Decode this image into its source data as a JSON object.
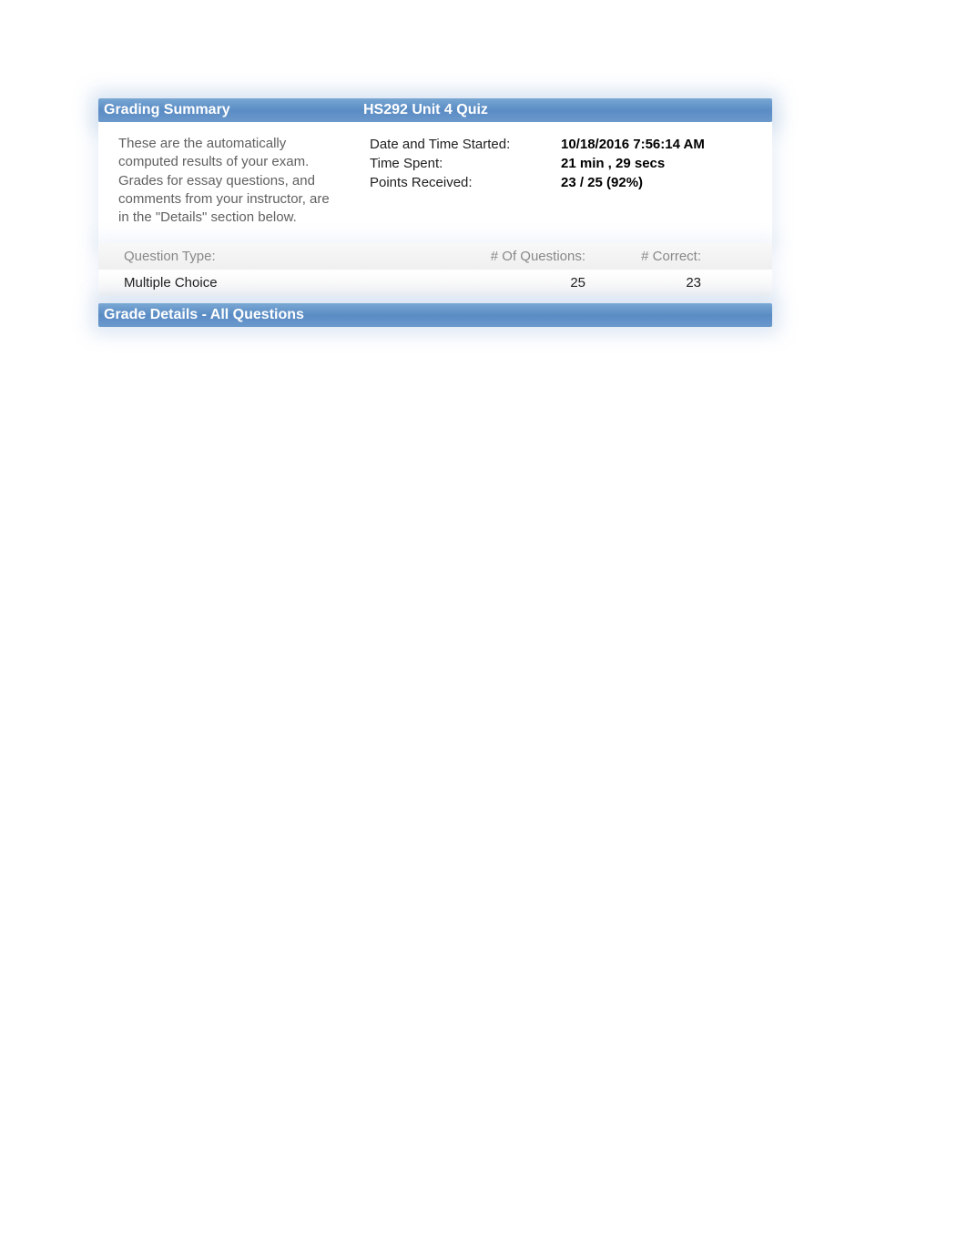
{
  "header": {
    "grading_summary": "Grading Summary",
    "quiz_title": "HS292 Unit 4 Quiz"
  },
  "description": "These are the automatically computed results of your exam. Grades for essay questions, and comments from your instructor, are in the \"Details\" section below.",
  "stats": {
    "labels": {
      "date_time": "Date and Time Started:",
      "time_spent": "Time Spent:",
      "points_received": "Points Received:"
    },
    "values": {
      "date_time": "10/18/2016 7:56:14 AM",
      "time_spent": "21 min , 29 secs",
      "points_received": "23 / 25 (92%)"
    }
  },
  "table": {
    "headers": {
      "question_type": "Question Type:",
      "num_questions": "# Of Questions:",
      "num_correct": "# Correct:"
    },
    "rows": [
      {
        "type": "Multiple Choice",
        "questions": "25",
        "correct": "23"
      }
    ]
  },
  "details_header": "Grade Details - All Questions"
}
